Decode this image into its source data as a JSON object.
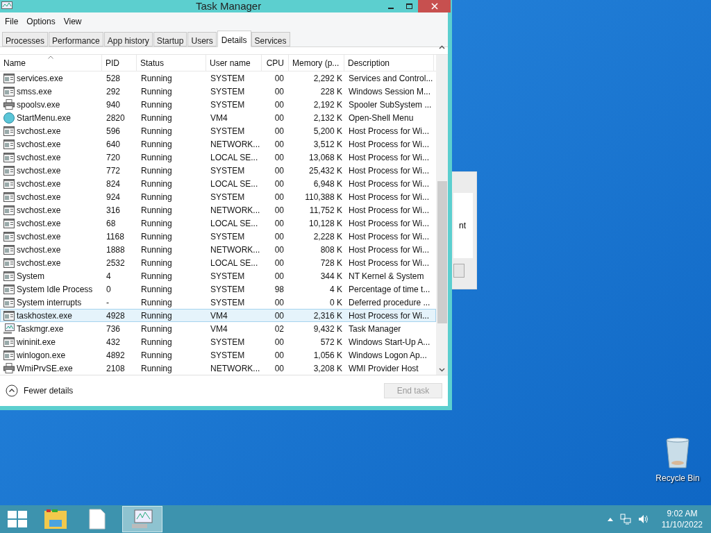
{
  "window": {
    "title": "Task Manager"
  },
  "menu": [
    "File",
    "Options",
    "View"
  ],
  "tabs": [
    {
      "label": "Processes",
      "selected": false
    },
    {
      "label": "Performance",
      "selected": false
    },
    {
      "label": "App history",
      "selected": false
    },
    {
      "label": "Startup",
      "selected": false
    },
    {
      "label": "Users",
      "selected": false
    },
    {
      "label": "Details",
      "selected": true
    },
    {
      "label": "Services",
      "selected": false
    }
  ],
  "table": {
    "columns": [
      "Name",
      "PID",
      "Status",
      "User name",
      "CPU",
      "Memory (p...",
      "Description"
    ],
    "rows": [
      {
        "kind": "app",
        "cells": [
          "services.exe",
          "528",
          "Running",
          "SYSTEM",
          "00",
          "2,292 K",
          "Services and Control..."
        ],
        "selected": false
      },
      {
        "kind": "app",
        "cells": [
          "smss.exe",
          "292",
          "Running",
          "SYSTEM",
          "00",
          "228 K",
          "Windows Session M..."
        ],
        "selected": false
      },
      {
        "kind": "printer",
        "cells": [
          "spoolsv.exe",
          "940",
          "Running",
          "SYSTEM",
          "00",
          "2,192 K",
          "Spooler SubSystem ..."
        ],
        "selected": false
      },
      {
        "kind": "shell",
        "cells": [
          "StartMenu.exe",
          "2820",
          "Running",
          "VM4",
          "00",
          "2,132 K",
          "Open-Shell Menu"
        ],
        "selected": false
      },
      {
        "kind": "app",
        "cells": [
          "svchost.exe",
          "596",
          "Running",
          "SYSTEM",
          "00",
          "5,200 K",
          "Host Process for Wi..."
        ],
        "selected": false
      },
      {
        "kind": "app",
        "cells": [
          "svchost.exe",
          "640",
          "Running",
          "NETWORK...",
          "00",
          "3,512 K",
          "Host Process for Wi..."
        ],
        "selected": false
      },
      {
        "kind": "app",
        "cells": [
          "svchost.exe",
          "720",
          "Running",
          "LOCAL SE...",
          "00",
          "13,068 K",
          "Host Process for Wi..."
        ],
        "selected": false
      },
      {
        "kind": "app",
        "cells": [
          "svchost.exe",
          "772",
          "Running",
          "SYSTEM",
          "00",
          "25,432 K",
          "Host Process for Wi..."
        ],
        "selected": false
      },
      {
        "kind": "app",
        "cells": [
          "svchost.exe",
          "824",
          "Running",
          "LOCAL SE...",
          "00",
          "6,948 K",
          "Host Process for Wi..."
        ],
        "selected": false
      },
      {
        "kind": "app",
        "cells": [
          "svchost.exe",
          "924",
          "Running",
          "SYSTEM",
          "00",
          "110,388 K",
          "Host Process for Wi..."
        ],
        "selected": false
      },
      {
        "kind": "app",
        "cells": [
          "svchost.exe",
          "316",
          "Running",
          "NETWORK...",
          "00",
          "11,752 K",
          "Host Process for Wi..."
        ],
        "selected": false
      },
      {
        "kind": "app",
        "cells": [
          "svchost.exe",
          "68",
          "Running",
          "LOCAL SE...",
          "00",
          "10,128 K",
          "Host Process for Wi..."
        ],
        "selected": false
      },
      {
        "kind": "app",
        "cells": [
          "svchost.exe",
          "1168",
          "Running",
          "SYSTEM",
          "00",
          "2,228 K",
          "Host Process for Wi..."
        ],
        "selected": false
      },
      {
        "kind": "app",
        "cells": [
          "svchost.exe",
          "1888",
          "Running",
          "NETWORK...",
          "00",
          "808 K",
          "Host Process for Wi..."
        ],
        "selected": false
      },
      {
        "kind": "app",
        "cells": [
          "svchost.exe",
          "2532",
          "Running",
          "LOCAL SE...",
          "00",
          "728 K",
          "Host Process for Wi..."
        ],
        "selected": false
      },
      {
        "kind": "app",
        "cells": [
          "System",
          "4",
          "Running",
          "SYSTEM",
          "00",
          "344 K",
          "NT Kernel & System"
        ],
        "selected": false
      },
      {
        "kind": "app",
        "cells": [
          "System Idle Process",
          "0",
          "Running",
          "SYSTEM",
          "98",
          "4 K",
          "Percentage of time t..."
        ],
        "selected": false
      },
      {
        "kind": "app",
        "cells": [
          "System interrupts",
          "-",
          "Running",
          "SYSTEM",
          "00",
          "0 K",
          "Deferred procedure ..."
        ],
        "selected": false
      },
      {
        "kind": "app",
        "cells": [
          "taskhostex.exe",
          "4928",
          "Running",
          "VM4",
          "00",
          "2,316 K",
          "Host Process for Wi..."
        ],
        "selected": true
      },
      {
        "kind": "monitor",
        "cells": [
          "Taskmgr.exe",
          "736",
          "Running",
          "VM4",
          "02",
          "9,432 K",
          "Task Manager"
        ],
        "selected": false
      },
      {
        "kind": "app",
        "cells": [
          "wininit.exe",
          "432",
          "Running",
          "SYSTEM",
          "00",
          "572 K",
          "Windows Start-Up A..."
        ],
        "selected": false
      },
      {
        "kind": "app",
        "cells": [
          "winlogon.exe",
          "4892",
          "Running",
          "SYSTEM",
          "00",
          "1,056 K",
          "Windows Logon Ap..."
        ],
        "selected": false
      },
      {
        "kind": "printer",
        "cells": [
          "WmiPrvSE.exe",
          "2108",
          "Running",
          "NETWORK...",
          "00",
          "3,208 K",
          "WMI Provider Host"
        ],
        "selected": false
      }
    ]
  },
  "footer": {
    "toggle": "Fewer details",
    "button": {
      "label": "End task",
      "disabled": true
    }
  },
  "background_window": {
    "text": "nt"
  },
  "desktop": {
    "icons": [
      "Recycle Bin"
    ]
  },
  "taskbar": {
    "time": "9:02 AM",
    "date": "11/10/2022"
  }
}
